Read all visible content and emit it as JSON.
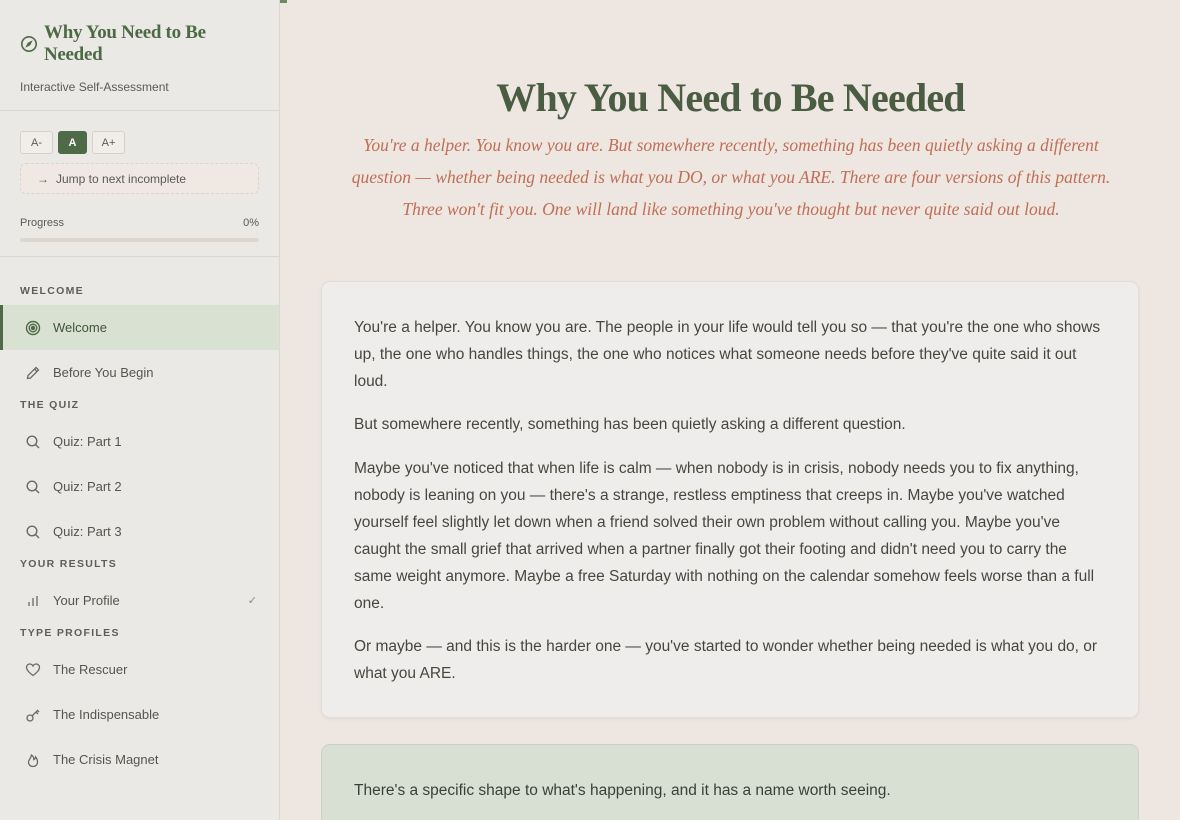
{
  "brand": {
    "title": "Why You Need to Be Needed",
    "subtitle": "Interactive Self-Assessment"
  },
  "controls": {
    "font_small": "A-",
    "font_normal": "A",
    "font_large": "A+",
    "jump_label": "Jump to next incomplete",
    "progress_label": "Progress",
    "progress_value": "0%",
    "progress_fraction": 0
  },
  "nav": {
    "sections": [
      {
        "label": "WELCOME",
        "items": [
          {
            "label": "Welcome",
            "icon": "target-icon",
            "active": true
          },
          {
            "label": "Before You Begin",
            "icon": "pencil-icon"
          }
        ]
      },
      {
        "label": "THE QUIZ",
        "items": [
          {
            "label": "Quiz: Part 1",
            "icon": "search-icon"
          },
          {
            "label": "Quiz: Part 2",
            "icon": "search-icon"
          },
          {
            "label": "Quiz: Part 3",
            "icon": "search-icon"
          }
        ]
      },
      {
        "label": "YOUR RESULTS",
        "items": [
          {
            "label": "Your Profile",
            "icon": "bar-chart-icon",
            "check": "✓"
          }
        ]
      },
      {
        "label": "TYPE PROFILES",
        "items": [
          {
            "label": "The Rescuer",
            "icon": "heart-icon"
          },
          {
            "label": "The Indispensable",
            "icon": "key-icon"
          },
          {
            "label": "The Crisis Magnet",
            "icon": "flame-icon"
          }
        ]
      }
    ]
  },
  "main": {
    "title": "Why You Need to Be Needed",
    "subtitle": "You're a helper. You know you are. But somewhere recently, something has been quietly asking a different question — whether being needed is what you DO, or what you ARE. There are four versions of this pattern. Three won't fit you. One will land like something you've thought but never quite said out loud.",
    "paragraphs": [
      "You're a helper. You know you are. The people in your life would tell you so — that you're the one who shows up, the one who handles things, the one who notices what someone needs before they've quite said it out loud.",
      "But somewhere recently, something has been quietly asking a different question.",
      "Maybe you've noticed that when life is calm — when nobody is in crisis, nobody needs you to fix anything, nobody is leaning on you — there's a strange, restless emptiness that creeps in. Maybe you've watched yourself feel slightly let down when a friend solved their own problem without calling you. Maybe you've caught the small grief that arrived when a partner finally got their footing and didn't need you to carry the same weight anymore. Maybe a free Saturday with nothing on the calendar somehow feels worse than a full one.",
      "Or maybe — and this is the harder one — you've started to wonder whether being needed is what you do, or what you ARE."
    ],
    "callout": "There's a specific shape to what's happening, and it has a name worth seeing."
  },
  "colors": {
    "accent": "#4f6a47",
    "subtitle": "#c06f55",
    "background": "#ede6e1",
    "sidebar": "#ebe9e6"
  }
}
